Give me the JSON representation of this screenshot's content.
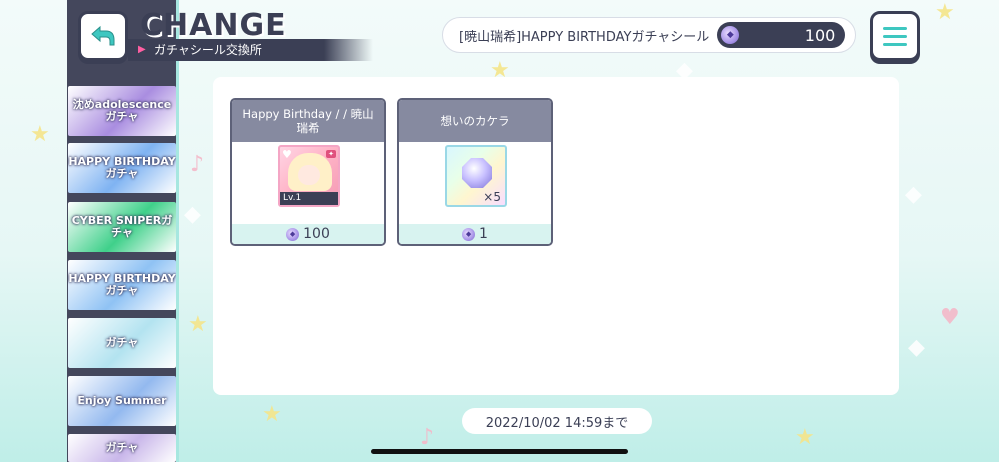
{
  "header": {
    "title": "CHANGE",
    "subtitle": "ガチャシール交換所",
    "currency_label": "[暁山瑞希]HAPPY BIRTHDAYガチャシール",
    "currency_amount": "100",
    "back_icon": "back-arrow-icon",
    "menu_icon": "hamburger-menu-icon"
  },
  "sidebar": {
    "banners": [
      {
        "label": "沈めadolescenceガチャ",
        "color": "#a98de0"
      },
      {
        "label": "HAPPY BIRTHDAYガチャ",
        "color": "#7fb3f2"
      },
      {
        "label": "CYBER SNIPERガチャ",
        "color": "#3fd08a"
      },
      {
        "label": "HAPPY BIRTHDAYガチャ",
        "color": "#8fc2f4"
      },
      {
        "label": "ガチャ",
        "color": "#b3e3f0"
      },
      {
        "label": "Enjoy Summer",
        "color": "#93b9ef"
      },
      {
        "label": "ガチャ",
        "color": "#c9b7ea"
      }
    ]
  },
  "items": [
    {
      "name": "Happy Birthday / / 暁山瑞希",
      "thumb_level": "Lv.1",
      "price": "100"
    },
    {
      "name": "想いのカケラ",
      "quantity": "×5",
      "price": "1"
    }
  ],
  "footer": {
    "deadline": "2022/10/02 14:59まで"
  },
  "colors": {
    "dark": "#3b3f55",
    "accent": "#3ec7c0",
    "pink": "#ff5fa2"
  }
}
